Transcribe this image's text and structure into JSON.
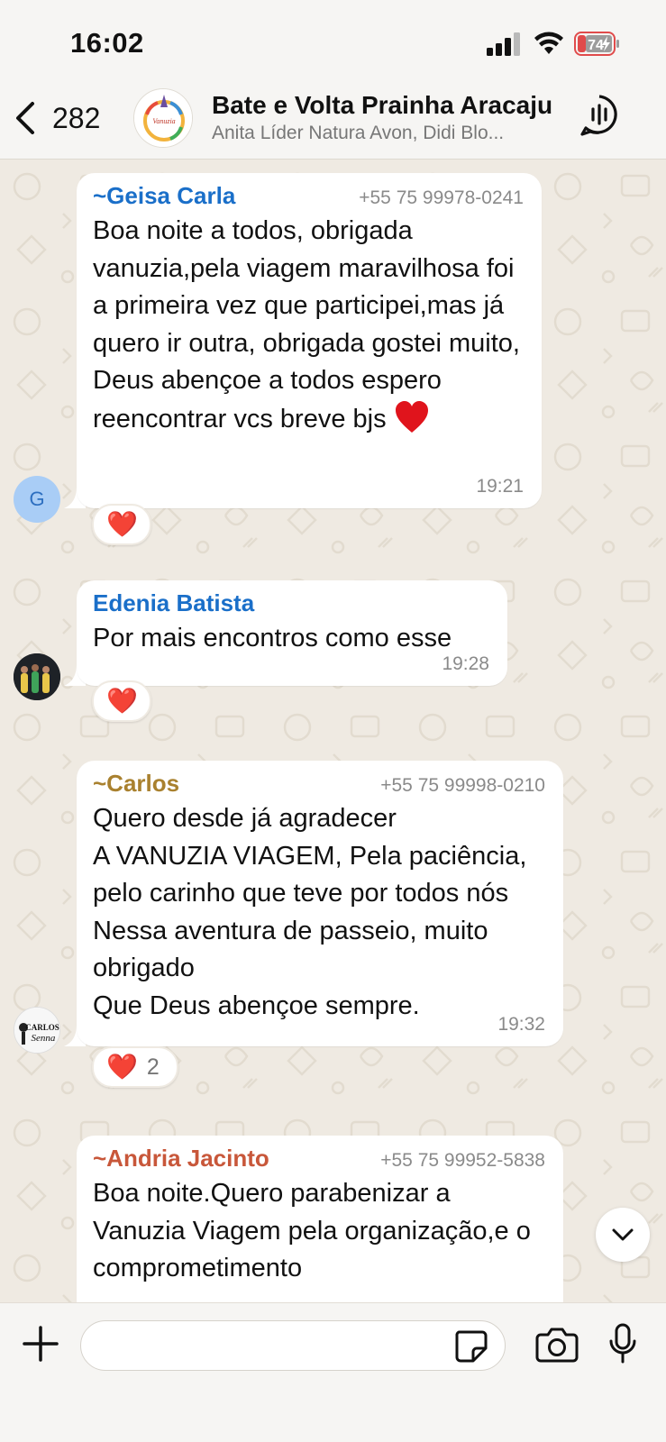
{
  "status_bar": {
    "time": "16:02",
    "battery": "74"
  },
  "header": {
    "back_count": "282",
    "title": "Bate e Volta Prainha Aracaju",
    "subtitle": "Anita Líder  Natura  Avon, Didi Blo...",
    "avatar_text": "Vanuzia"
  },
  "messages": [
    {
      "sender": "~Geisa Carla",
      "sender_color": "#1a6fc9",
      "phone": "+55 75 99978-0241",
      "text": "Boa noite a todos, obrigada vanuzia,pela viagem maravilhosa foi a primeira vez que participei,mas já quero ir outra, obrigada gostei muito, Deus abençoe a todos espero reencontrar vcs breve bjs",
      "time": "19:21",
      "avatar_letter": "G",
      "reaction": "❤️",
      "reaction_count": ""
    },
    {
      "sender": "Edenia Batista",
      "sender_color": "#1a6fc9",
      "phone": "",
      "text": "Por mais encontros como esse",
      "time": "19:28",
      "reaction": "❤️",
      "reaction_count": ""
    },
    {
      "sender": "~Carlos",
      "sender_color": "#a9812f",
      "phone": "+55 75 99998-0210",
      "text": "Quero desde já  agradecer\nA VANUZIA  VIAGEM, Pela paciência, pelo carinho  que  teve por todos nós\nNessa aventura  de passeio, muito obrigado\nQue Deus abençoe sempre.",
      "time": "19:32",
      "avatar_text_1": "CARLOS",
      "avatar_text_2": "Senna",
      "reaction": "❤️",
      "reaction_count": "2"
    },
    {
      "sender": "~Andria Jacinto",
      "sender_color": "#c8573a",
      "phone": "+55 75 99952-5838",
      "text": "Boa noite.Quero parabenizar a Vanuzia Viagem pela organização,e o comprometimento"
    }
  ],
  "input": {
    "placeholder": ""
  },
  "icons": {
    "back": "chevron-left-icon",
    "call": "group-call-icon",
    "scroll": "chevron-down-icon",
    "plus": "plus-icon",
    "sticker": "sticker-icon",
    "camera": "camera-icon",
    "mic": "microphone-icon"
  }
}
